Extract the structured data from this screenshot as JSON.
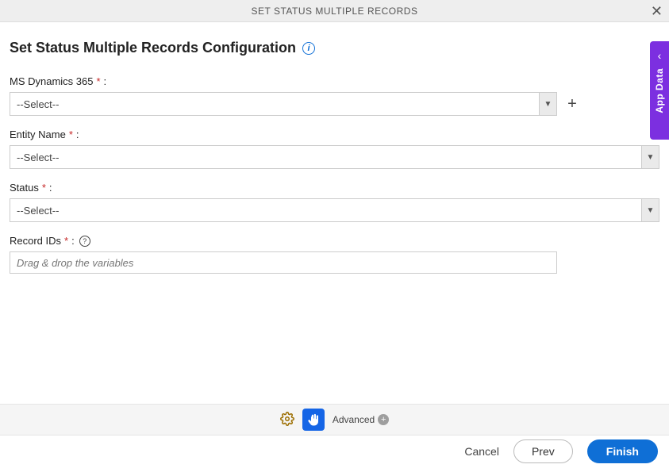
{
  "titlebar": {
    "title": "SET STATUS MULTIPLE RECORDS"
  },
  "heading": "Set Status Multiple Records Configuration",
  "fields": {
    "msdynamics": {
      "label": "MS Dynamics 365 ",
      "value": "--Select--"
    },
    "entity": {
      "label": "Entity Name ",
      "value": "--Select--"
    },
    "status": {
      "label": "Status ",
      "value": "--Select--"
    },
    "recordids": {
      "label": "Record IDs ",
      "placeholder": "Drag & drop the variables"
    }
  },
  "required_marker": "*",
  "colon": ":",
  "toolbar": {
    "advanced": "Advanced"
  },
  "footer": {
    "cancel": "Cancel",
    "prev": "Prev",
    "finish": "Finish"
  },
  "side": {
    "label": "App Data"
  }
}
